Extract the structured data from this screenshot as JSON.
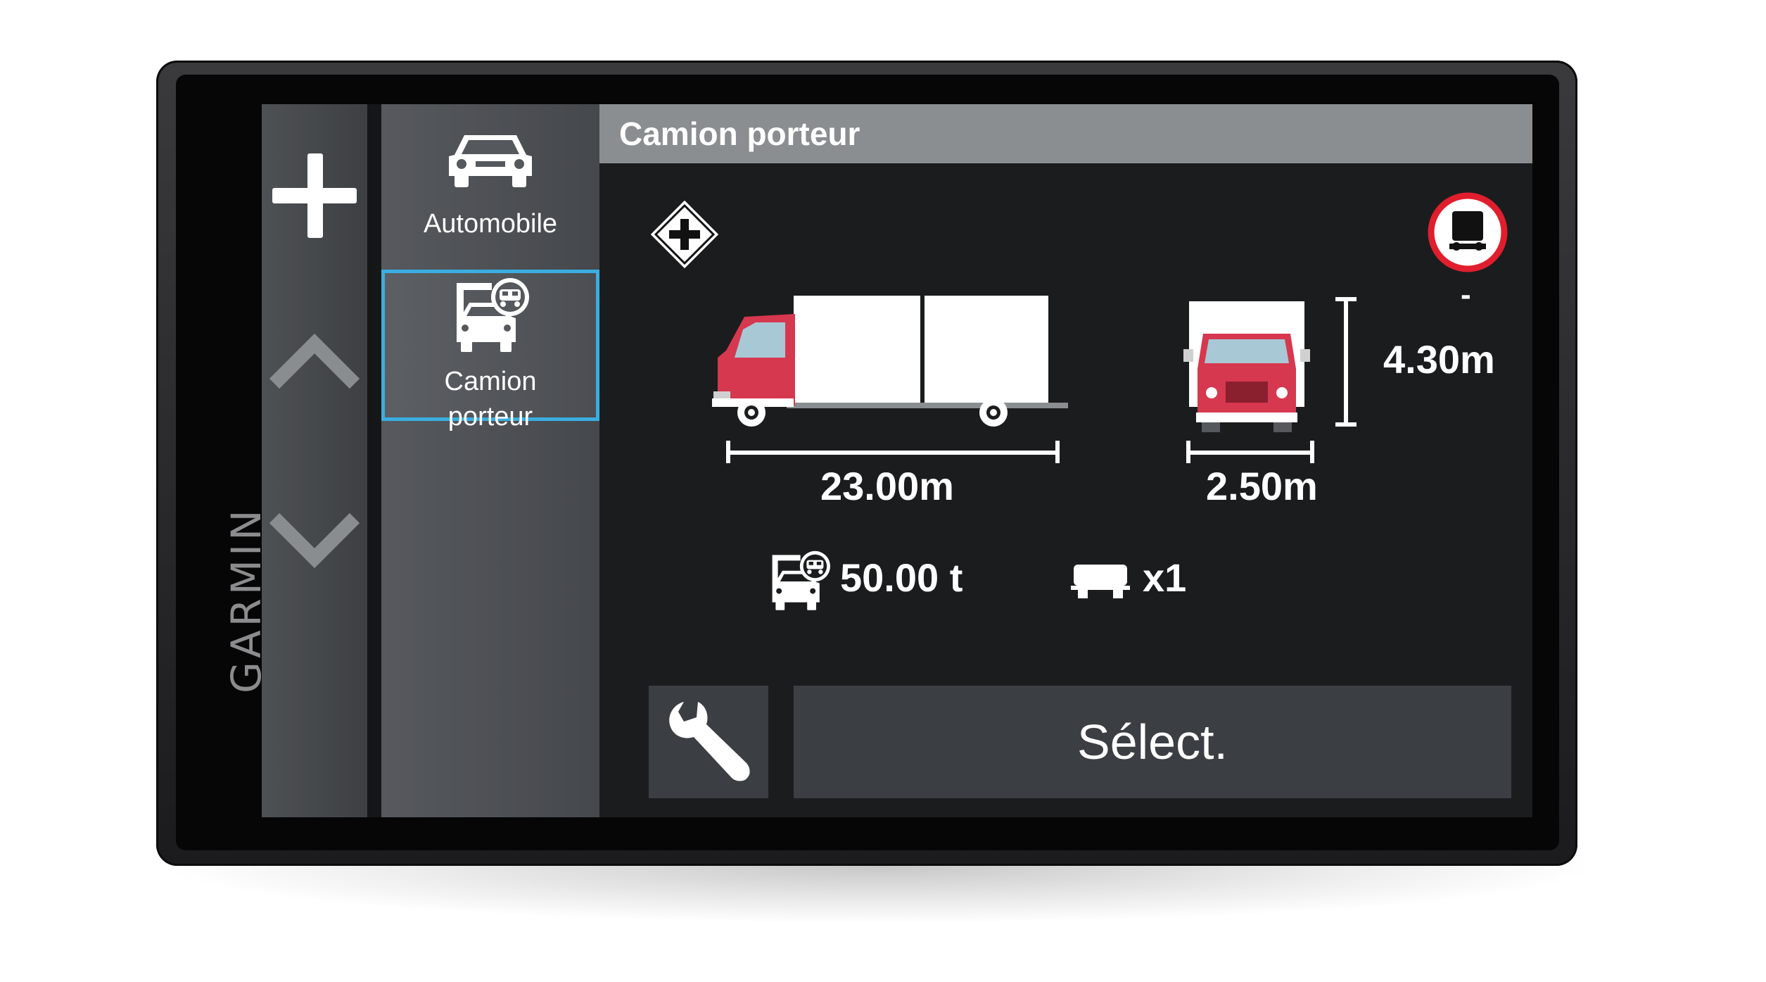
{
  "device": {
    "brand": "GARMIN"
  },
  "nav": {
    "add_icon": "plus-icon",
    "up_icon": "chevron-up-icon",
    "down_icon": "chevron-down-icon"
  },
  "profiles": [
    {
      "label": "Automobile",
      "icon": "car-icon",
      "selected": false
    },
    {
      "label": "Camion\nporteur",
      "icon": "truck-profile-icon",
      "selected": true
    }
  ],
  "header": {
    "title": "Camion porteur"
  },
  "vehicle": {
    "length": "23.00m",
    "width": "2.50m",
    "height": "4.30m",
    "weight": "50.00 t",
    "axle_count": "x1",
    "hazmat_value": "-"
  },
  "actions": {
    "select_label": "Sélect.",
    "settings_icon": "wrench-icon"
  },
  "colors": {
    "accent": "#3aaee0",
    "truck_red": "#d6384f",
    "warning_red": "#e01e2d"
  }
}
